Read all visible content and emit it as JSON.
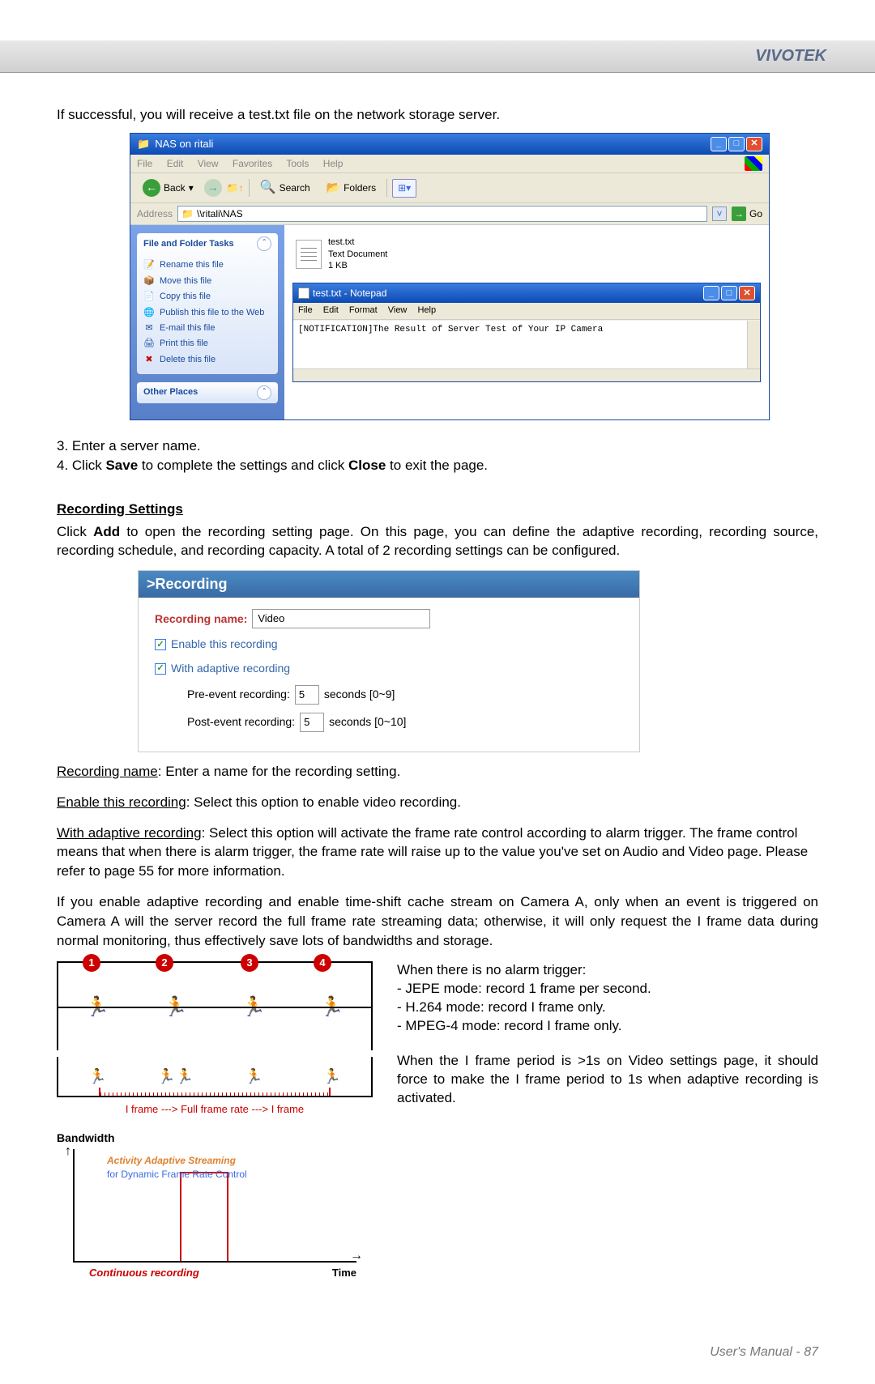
{
  "header": {
    "brand": "VIVOTEK"
  },
  "intro": "If successful, you will receive a test.txt file on the network storage server.",
  "explorer": {
    "title": "NAS on ritali",
    "menu": {
      "file": "File",
      "edit": "Edit",
      "view": "View",
      "favorites": "Favorites",
      "tools": "Tools",
      "help": "Help"
    },
    "toolbar": {
      "back": "Back",
      "search": "Search",
      "folders": "Folders"
    },
    "address_label": "Address",
    "address_value": "\\\\ritali\\NAS",
    "go": "Go",
    "task_panel": {
      "heading": "File and Folder Tasks",
      "items": [
        "Rename this file",
        "Move this file",
        "Copy this file",
        "Publish this file to the Web",
        "E-mail this file",
        "Print this file",
        "Delete this file"
      ],
      "other": "Other Places"
    },
    "file": {
      "name": "test.txt",
      "type": "Text Document",
      "size": "1 KB"
    }
  },
  "notepad": {
    "title": "test.txt - Notepad",
    "menu": {
      "file": "File",
      "edit": "Edit",
      "format": "Format",
      "view": "View",
      "help": "Help"
    },
    "content": "[NOTIFICATION]The Result of Server Test of Your IP Camera"
  },
  "steps": {
    "s3": "3. Enter a server name.",
    "s4_pre": "4. Click ",
    "s4_save": "Save",
    "s4_mid": " to complete the settings and click ",
    "s4_close": "Close",
    "s4_post": " to exit the page."
  },
  "recording_section": {
    "heading": "Recording Settings",
    "intro_pre": "Click ",
    "intro_add": "Add",
    "intro_post": " to open the recording setting page. On this page, you can define the adaptive recording, recording source, recording schedule, and recording capacity. A total of 2 recording settings can be configured."
  },
  "recording_panel": {
    "title": ">Recording",
    "name_label": "Recording name:",
    "name_value": "Video",
    "enable": "Enable this recording",
    "adaptive": "With adaptive recording",
    "pre_label": "Pre-event recording:",
    "pre_value": "5",
    "pre_range": "seconds [0~9]",
    "post_label": "Post-event recording:",
    "post_value": "5",
    "post_range": "seconds [0~10]"
  },
  "body_text": {
    "t1_label": "Recording name",
    "t1": ": Enter a name for the recording setting.",
    "t2_label": "Enable this recording",
    "t2": ": Select this option to enable video recording.",
    "t3_label": "With adaptive recording",
    "t3": ": Select this option will activate the frame rate control according to alarm trigger. The frame control means that when there is alarm trigger, the frame rate will raise up to the value you've set on Audio and Video page. Please refer to page 55 for more information.",
    "t4": "If you enable adaptive recording and enable time-shift cache stream on Camera A, only when an event is triggered on Camera A will the server record the full frame rate streaming data; otherwise, it will only request the I frame data during normal monitoring, thus effectively save lots of bandwidths and storage."
  },
  "diagram": {
    "markers": [
      "1",
      "2",
      "3",
      "4"
    ],
    "timeline_label": "I frame   --->   Full frame rate   --->   I frame",
    "bandwidth": "Bandwidth",
    "aas": "Activity Adaptive Streaming",
    "dfc": "for Dynamic Frame Rate Control",
    "cr": "Continuous recording",
    "time": "Time"
  },
  "right_text": {
    "heading1": "When there is no alarm trigger:",
    "l1": "- JEPE mode: record 1 frame per second.",
    "l2": "- H.264 mode: record I frame only.",
    "l3": "- MPEG-4 mode: record I frame only.",
    "para2": "When the I frame period is >1s on Video settings page, it should force to make the I frame period to 1s when adaptive recording is activated."
  },
  "footer": {
    "label": "User's Manual - ",
    "page": "87"
  }
}
